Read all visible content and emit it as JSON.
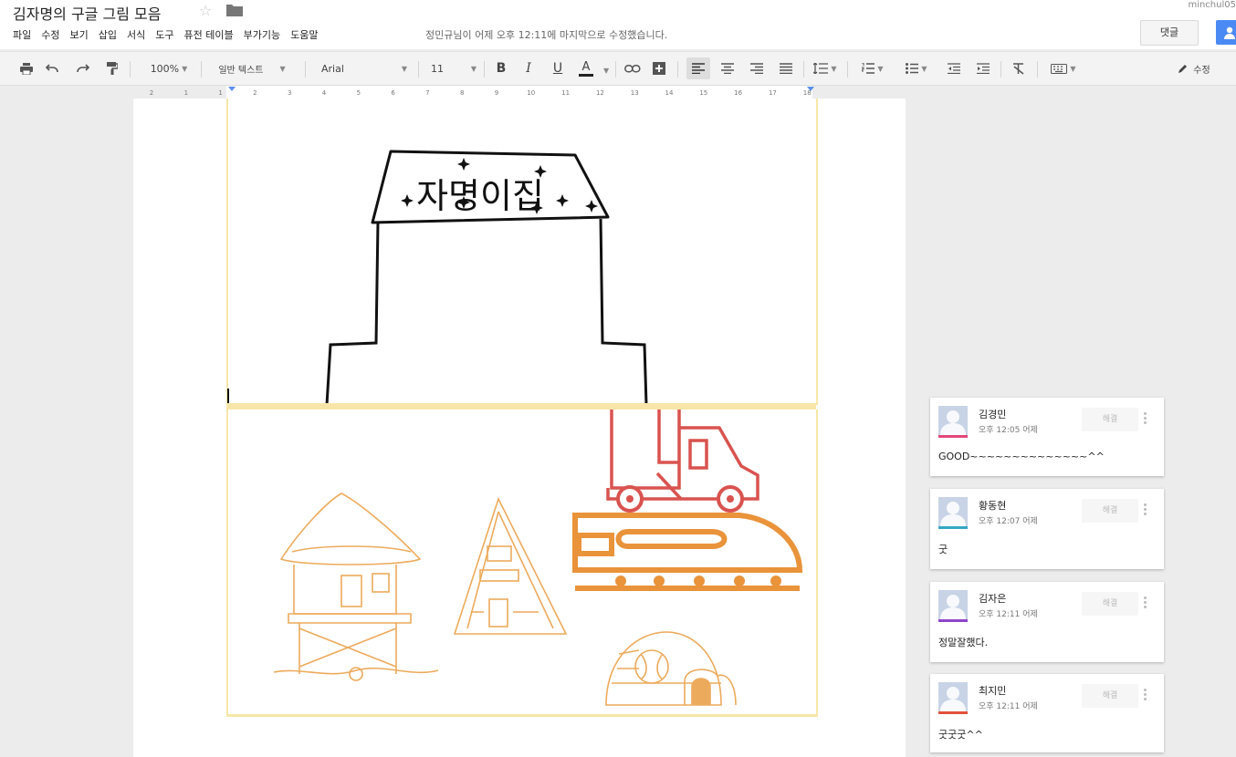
{
  "header": {
    "title": "김자명의 구글 그림 모음",
    "user": "minchul05",
    "last_edit": "정민규님이 어제 오후 12:11에 마지막으로 수정했습니다.",
    "comment_button": "댓글"
  },
  "menu": [
    "파일",
    "수정",
    "보기",
    "삽입",
    "서식",
    "도구",
    "퓨전 테이블",
    "부가기능",
    "도움말"
  ],
  "toolbar": {
    "zoom": "100%",
    "style": "일반 텍스트",
    "font": "Arial",
    "size": "11",
    "bold": "B",
    "italic": "I",
    "underline": "U",
    "text_color": "A",
    "edit_mode": "수정"
  },
  "ruler": {
    "marks": [
      "2",
      "1",
      "1",
      "2",
      "3",
      "4",
      "5",
      "6",
      "7",
      "8",
      "9",
      "10",
      "11",
      "12",
      "13",
      "14",
      "15",
      "16",
      "17",
      "18"
    ]
  },
  "drawing": {
    "sign_text": "자명이집"
  },
  "comments": [
    {
      "name": "김경민",
      "time": "오후 12:05 어제",
      "text": "GOOD~~~~~~~~~~~~~~^^",
      "resolve": "해결",
      "color": "#e2477a"
    },
    {
      "name": "황동현",
      "time": "오후 12:07 어제",
      "text": "굿",
      "resolve": "해결",
      "color": "#35a7c2"
    },
    {
      "name": "김자은",
      "time": "오후 12:11 어제",
      "text": "정말잘했다.",
      "resolve": "해결",
      "color": "#8e44c8"
    },
    {
      "name": "최지민",
      "time": "오후 12:11 어제",
      "text": "굿굿굿^^",
      "resolve": "해결",
      "color": "#e0523a"
    }
  ],
  "colors": {
    "accent_blue": "#4a8af4",
    "drawing_border": "#f7e6a8",
    "orange": "#e9933a",
    "red_truck": "#d9534f"
  }
}
